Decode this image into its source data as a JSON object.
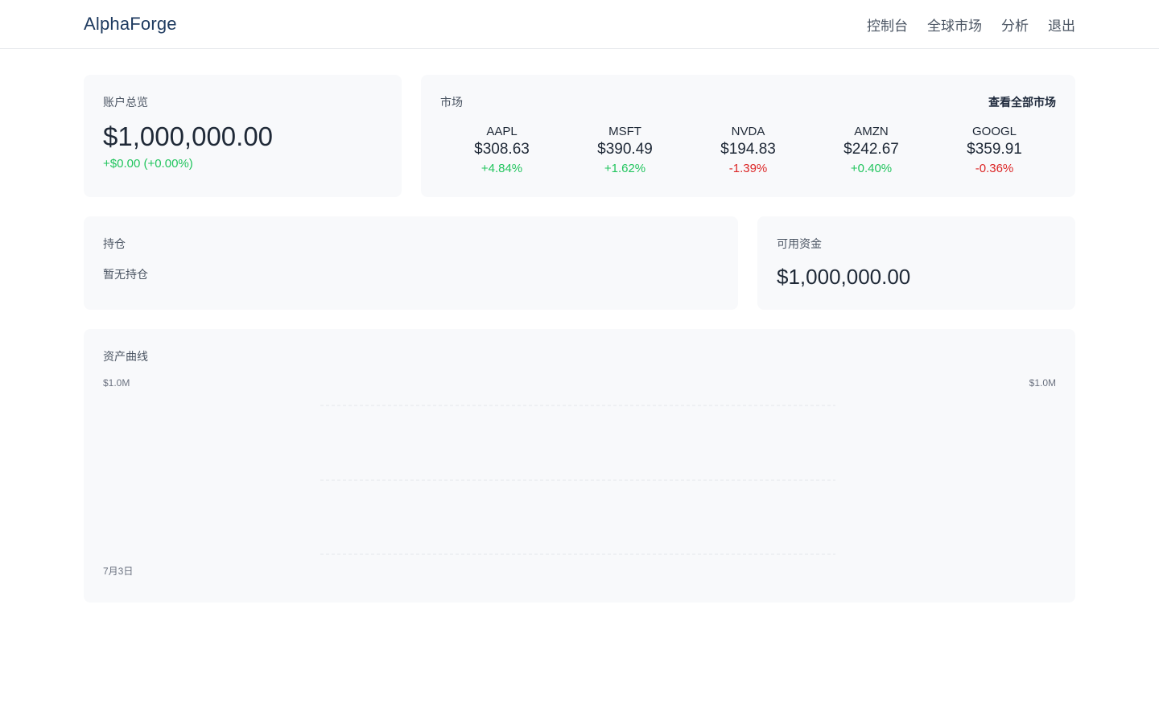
{
  "header": {
    "brand": "AlphaForge",
    "nav": [
      "控制台",
      "全球市场",
      "分析",
      "退出"
    ]
  },
  "overview": {
    "label": "账户总览",
    "balance": "$1,000,000.00",
    "change": "+$0.00 (+0.00%)"
  },
  "market": {
    "label": "市场",
    "view_all": "查看全部市场",
    "tickers": [
      {
        "symbol": "AAPL",
        "price": "$308.63",
        "change": "+4.84%",
        "direction": "up"
      },
      {
        "symbol": "MSFT",
        "price": "$390.49",
        "change": "+1.62%",
        "direction": "up"
      },
      {
        "symbol": "NVDA",
        "price": "$194.83",
        "change": "-1.39%",
        "direction": "down"
      },
      {
        "symbol": "AMZN",
        "price": "$242.67",
        "change": "+0.40%",
        "direction": "up"
      },
      {
        "symbol": "GOOGL",
        "price": "$359.91",
        "change": "-0.36%",
        "direction": "down"
      }
    ]
  },
  "holdings": {
    "label": "持仓",
    "empty": "暂无持仓"
  },
  "cash": {
    "label": "可用资金",
    "value": "$1,000,000.00"
  },
  "equity_curve": {
    "label": "资产曲线",
    "y_left": "$1.0M",
    "y_right": "$1.0M",
    "x_first": "7月3日"
  },
  "colors": {
    "positive": "#22c55e",
    "negative": "#dc2626",
    "card_bg": "#f8f9fb",
    "brand": "#1e3a5f"
  }
}
